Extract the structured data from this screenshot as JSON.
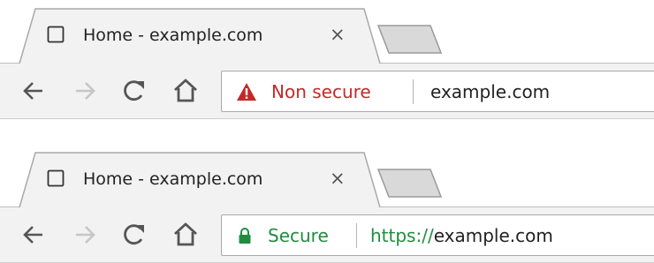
{
  "screens": [
    {
      "tab": {
        "title": "Home - example.com",
        "close_glyph": "×",
        "favicon": "page-icon"
      },
      "toolbar": {
        "back": "arrow-left-icon",
        "forward": "arrow-right-icon",
        "reload": "reload-icon",
        "home": "home-icon"
      },
      "omnibox": {
        "security_icon": "warning-triangle-icon",
        "security_label": "Non secure",
        "security_color": "#c62828",
        "url": "example.com"
      }
    },
    {
      "tab": {
        "title": "Home - example.com",
        "close_glyph": "×",
        "favicon": "page-icon"
      },
      "toolbar": {
        "back": "arrow-left-icon",
        "forward": "arrow-right-icon",
        "reload": "reload-icon",
        "home": "home-icon"
      },
      "omnibox": {
        "security_icon": "lock-icon",
        "security_label": "Secure",
        "security_color": "#1e8e3e",
        "url_scheme": "https://",
        "url": "example.com"
      }
    }
  ]
}
